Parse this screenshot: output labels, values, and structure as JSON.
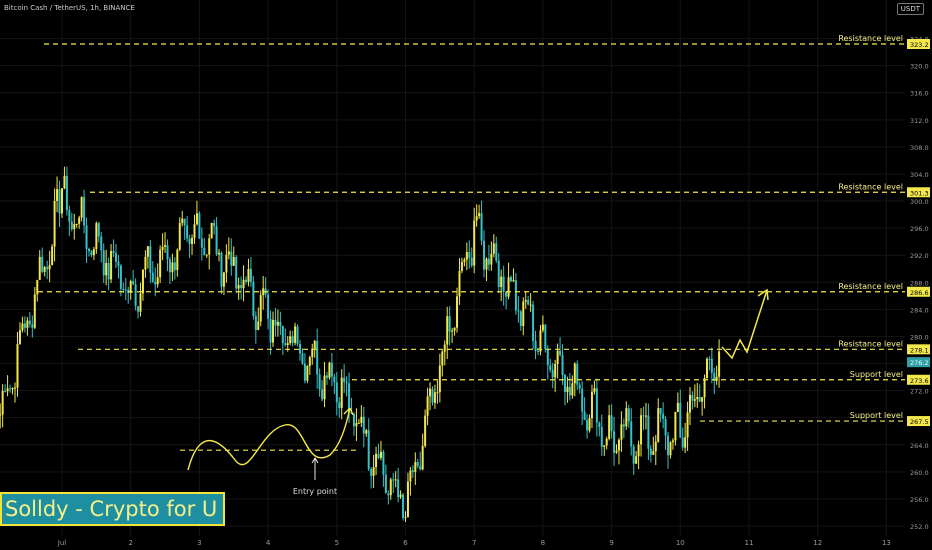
{
  "header": {
    "instrument": "Bitcoin Cash / TetherUS, 1h, BINANCE",
    "currency": "USDT"
  },
  "brand": {
    "text": "Solldy - Crypto for U"
  },
  "colors": {
    "background": "#000000",
    "up": "#f2e84b",
    "down": "#36c2c9",
    "line": "#f2e84b",
    "grid": "#141414",
    "axis_text": "#9a9a9a",
    "label_bg": "#f2e84b",
    "current_bg": "#30a0a8"
  },
  "chart_data": {
    "type": "candlestick",
    "title": "Bitcoin Cash / TetherUS, 1h, BINANCE",
    "xlabel": "",
    "ylabel": "",
    "ylim": [
      250.2,
      326.5
    ],
    "y_ticks": [
      "324.0",
      "320.0",
      "316.0",
      "312.0",
      "308.0",
      "304.0",
      "300.0",
      "296.0",
      "292.0",
      "288.0",
      "284.0",
      "280.0",
      "276.0",
      "272.0",
      "268.0",
      "264.0",
      "260.0",
      "256.0",
      "252.0"
    ],
    "x_ticks": [
      "Jul",
      "2",
      "3",
      "4",
      "5",
      "6",
      "7",
      "8",
      "9",
      "10",
      "11",
      "12",
      "13"
    ],
    "grid": true,
    "series": [
      {
        "segment": "Jul → Jul 1",
        "start": 268.5,
        "end": 300.0
      },
      {
        "segment": "Jul 1 → Jul 2",
        "start": 300.0,
        "end": 287.0
      },
      {
        "segment": "Jul 2 → Jul 3",
        "start": 287.0,
        "end": 296.0
      },
      {
        "segment": "Jul 3 → Jul 4",
        "start": 296.0,
        "end": 283.0
      },
      {
        "segment": "Jul 4 → Jul 5",
        "start": 283.0,
        "end": 273.0
      },
      {
        "segment": "Jul 5 → Jul 6",
        "start": 273.0,
        "end": 254.0
      },
      {
        "segment": "Jul 6 → Jul 7",
        "start": 254.0,
        "end": 296.0
      },
      {
        "segment": "Jul 7 → Jul 8",
        "start": 296.0,
        "end": 279.0
      },
      {
        "segment": "Jul 8 → Jul 9",
        "start": 279.0,
        "end": 265.0
      },
      {
        "segment": "Jul 9 → Jul 10",
        "start": 265.0,
        "end": 266.0
      },
      {
        "segment": "Jul 10 → Jul 10.6",
        "start": 266.0,
        "end": 278.5
      }
    ],
    "levels": [
      {
        "label": "Resistance level",
        "value": 323.2,
        "tag": "323.2"
      },
      {
        "label": "Resistance level",
        "value": 301.3,
        "tag": "301.3"
      },
      {
        "label": "Resistance level",
        "value": 286.6,
        "tag": "286.6"
      },
      {
        "label": "Resistance level",
        "value": 278.1,
        "tag": "278.1"
      },
      {
        "label": "Support level",
        "value": 273.6,
        "tag": "273.6"
      },
      {
        "label": "Support level",
        "value": 267.5,
        "tag": "267.5"
      }
    ],
    "current_price": {
      "value": 276.2,
      "tag": "276.2"
    },
    "entry_level": 263.2,
    "annotations": [
      {
        "text": "Entry point",
        "at_value": 263.2
      }
    ]
  }
}
